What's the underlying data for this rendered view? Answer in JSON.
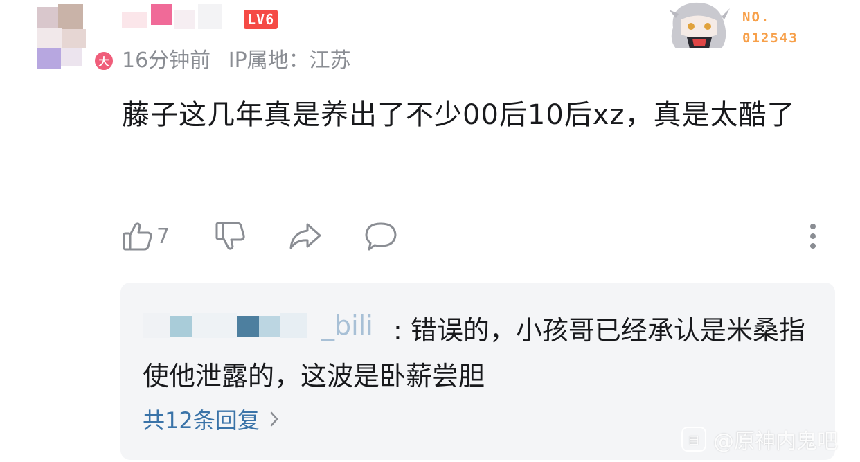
{
  "user": {
    "level_label": "LV6",
    "badge_label": "大"
  },
  "meta": {
    "time": "16分钟前",
    "ip": "IP属地：江苏"
  },
  "fan_card": {
    "number_line1": "NO.",
    "number_line2": "012543"
  },
  "comment": {
    "text": "藤子这几年真是养出了不少00后10后xz，真是太酷了"
  },
  "actions": {
    "like_count": "7"
  },
  "reply": {
    "name_tail": "_bili",
    "text": ": 错误的，小孩哥已经承认是米桑指使他泄露的，这波是卧薪尝胆",
    "more_label": "共12条回复"
  },
  "watermark": {
    "text": "@原神内鬼吧"
  },
  "colors": {
    "level_red": "#f54a45",
    "link_blue": "#3a73a8",
    "meta_gray": "#8a8d93",
    "fan_orange": "#f7a04a"
  }
}
